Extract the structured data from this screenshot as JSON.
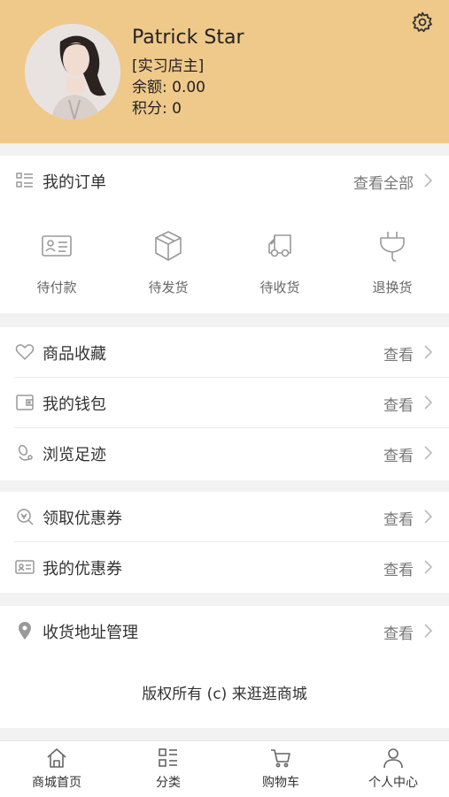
{
  "profile": {
    "name": "Patrick Star ",
    "role": "[实习店主]",
    "balance": "余额: 0.00",
    "points": "积分: 0"
  },
  "orders": {
    "title": "我的订单",
    "view_all": "查看全部",
    "statuses": [
      {
        "label": "待付款",
        "icon": "wallet-card-icon"
      },
      {
        "label": "待发货",
        "icon": "package-box-icon"
      },
      {
        "label": "待收货",
        "icon": "delivery-truck-icon"
      },
      {
        "label": "退换货",
        "icon": "return-plug-icon"
      }
    ]
  },
  "menu": {
    "favorites": {
      "label": "商品收藏",
      "action": "查看",
      "icon": "heart-icon"
    },
    "wallet": {
      "label": "我的钱包",
      "action": "查看",
      "icon": "wallet-icon"
    },
    "history": {
      "label": "浏览足迹",
      "action": "查看",
      "icon": "footprint-icon"
    },
    "get_coupons": {
      "label": "领取优惠券",
      "action": "查看",
      "icon": "coupon-search-icon"
    },
    "my_coupons": {
      "label": "我的优惠券",
      "action": "查看",
      "icon": "coupon-card-icon"
    },
    "address": {
      "label": "收货地址管理",
      "action": "查看",
      "icon": "location-pin-icon"
    }
  },
  "footer": {
    "copyright": "版权所有 (c) 来逛逛商城"
  },
  "tabbar": [
    {
      "label": "商城首页",
      "icon": "home-icon"
    },
    {
      "label": "分类",
      "icon": "category-list-icon"
    },
    {
      "label": "购物车",
      "icon": "cart-icon"
    },
    {
      "label": "个人中心",
      "icon": "person-icon"
    }
  ],
  "colors": {
    "header_bg": "#efc98a",
    "page_bg": "#f2f2f2",
    "icon_gray": "#999999"
  }
}
